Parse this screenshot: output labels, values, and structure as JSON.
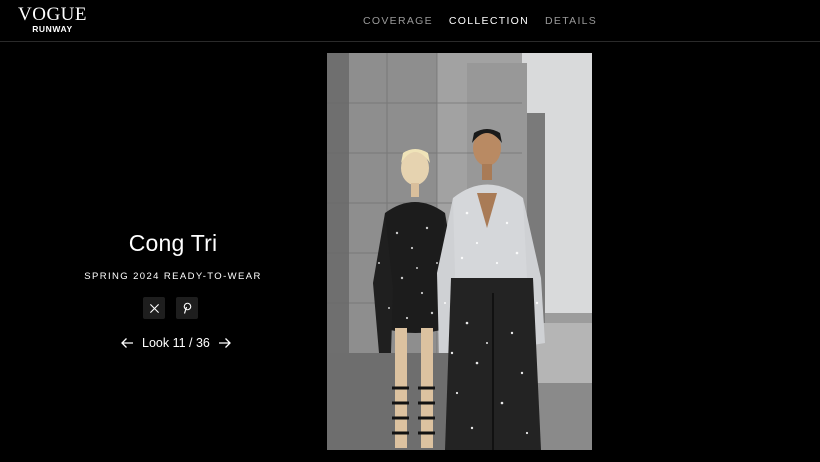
{
  "brand": {
    "name": "VOGUE",
    "sub": "RUNWAY"
  },
  "nav": {
    "items": [
      {
        "label": "COVERAGE",
        "active": false
      },
      {
        "label": "COLLECTION",
        "active": true
      },
      {
        "label": "DETAILS",
        "active": false
      }
    ]
  },
  "show": {
    "designer": "Cong Tri",
    "season": "SPRING 2024 READY-TO-WEAR"
  },
  "share": {
    "icons": [
      "x-twitter-icon",
      "pinterest-icon"
    ]
  },
  "pager": {
    "label": "Look 11 / 36",
    "current": 11,
    "total": 36
  },
  "colors": {
    "background": "#000000",
    "nav_inactive": "#9a9a9a",
    "button_bg": "#1e1e1e"
  }
}
